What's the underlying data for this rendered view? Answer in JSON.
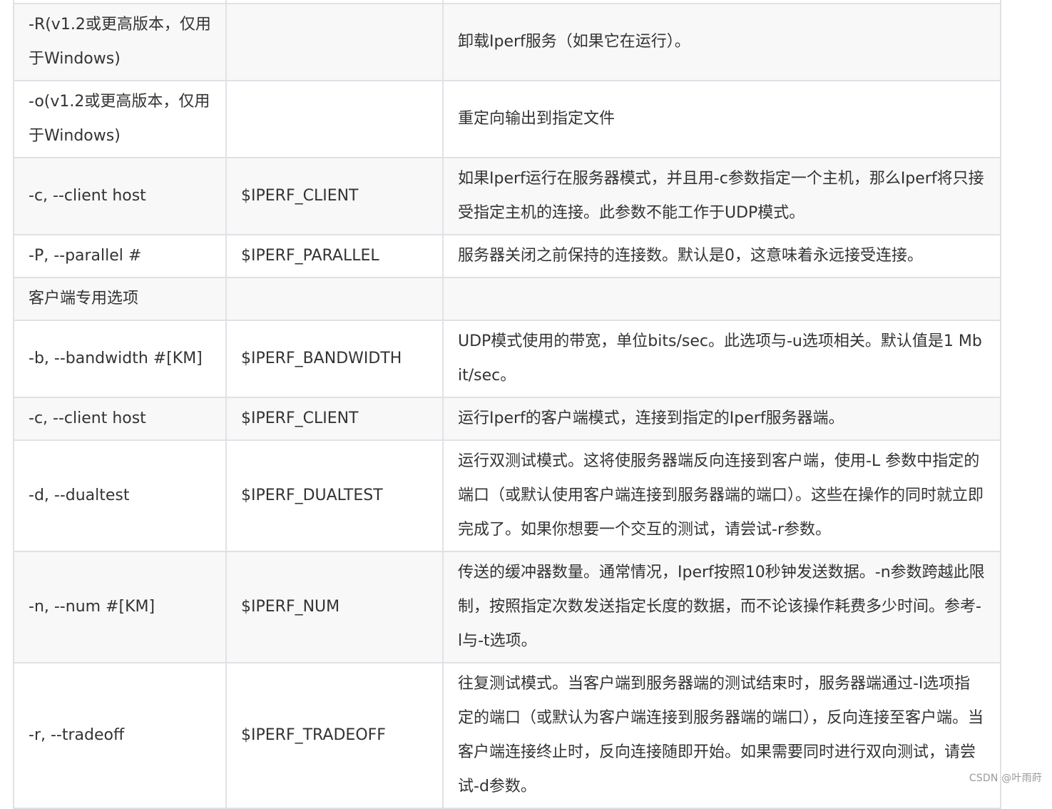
{
  "table": {
    "rows": [
      {
        "option": "",
        "env": "",
        "desc": ""
      },
      {
        "option": "-R(v1.2或更高版本，仅用于Windows)",
        "env": "",
        "desc": "卸载Iperf服务（如果它在运行）。"
      },
      {
        "option": "-o(v1.2或更高版本，仅用于Windows)",
        "env": "",
        "desc": "重定向输出到指定文件"
      },
      {
        "option": "-c, --client host",
        "env": "$IPERF_CLIENT",
        "desc": "如果Iperf运行在服务器模式，并且用-c参数指定一个主机，那么Iperf将只接受指定主机的连接。此参数不能工作于UDP模式。"
      },
      {
        "option": "-P, --parallel #",
        "env": "$IPERF_PARALLEL",
        "desc": "服务器关闭之前保持的连接数。默认是0，这意味着永远接受连接。"
      },
      {
        "option": "客户端专用选项",
        "env": "",
        "desc": ""
      },
      {
        "option": "-b, --bandwidth #[KM]",
        "env": "$IPERF_BANDWIDTH",
        "desc": "UDP模式使用的带宽，单位bits/sec。此选项与-u选项相关。默认值是1 Mbit/sec。"
      },
      {
        "option": "-c, --client host",
        "env": "$IPERF_CLIENT",
        "desc": "运行Iperf的客户端模式，连接到指定的Iperf服务器端。"
      },
      {
        "option": "-d, --dualtest",
        "env": "$IPERF_DUALTEST",
        "desc": "运行双测试模式。这将使服务器端反向连接到客户端，使用-L 参数中指定的端口（或默认使用客户端连接到服务器端的端口）。这些在操作的同时就立即完成了。如果你想要一个交互的测试，请尝试-r参数。"
      },
      {
        "option": "-n, --num #[KM]",
        "env": "$IPERF_NUM",
        "desc": "传送的缓冲器数量。通常情况，Iperf按照10秒钟发送数据。-n参数跨越此限制，按照指定次数发送指定长度的数据，而不论该操作耗费多少时间。参考-l与-t选项。"
      },
      {
        "option": "-r, --tradeoff",
        "env": "$IPERF_TRADEOFF",
        "desc": "往复测试模式。当客户端到服务器端的测试结束时，服务器端通过-l选项指定的端口（或默认为客户端连接到服务器端的端口），反向连接至客户端。当客户端连接终止时，反向连接随即开始。如果需要同时进行双向测试，请尝试-d参数。"
      }
    ]
  },
  "watermark": "CSDN @叶雨莳"
}
